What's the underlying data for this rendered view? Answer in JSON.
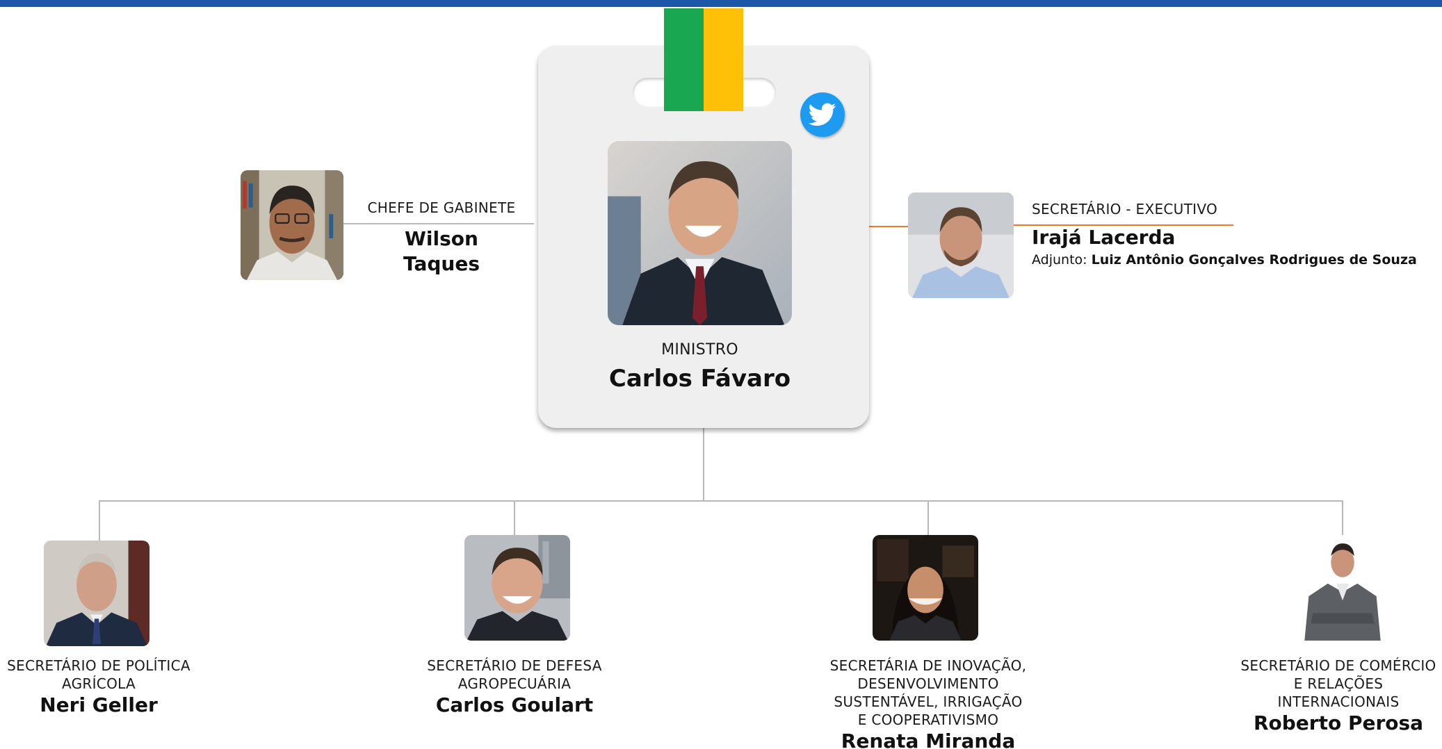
{
  "colors": {
    "top_rule": "#1d58a8",
    "connector": "#b8b8b8",
    "exec_connector": "#ef7d1e",
    "ribbon_green": "#1aa751",
    "ribbon_yellow": "#ffc107",
    "twitter": "#1d9bf0",
    "badge_bg": "#efefef"
  },
  "icons": {
    "twitter": "twitter-bird-icon"
  },
  "minister": {
    "role": "MINISTRO",
    "name": "Carlos Fávaro"
  },
  "chief_of_staff": {
    "role": "CHEFE DE GABINETE",
    "name_line1": "Wilson",
    "name_line2": "Taques"
  },
  "executive_secretary": {
    "role": "SECRETÁRIO - EXECUTIVO",
    "name": "Irajá Lacerda",
    "deputy_label": "Adjunto:",
    "deputy_name": "Luiz Antônio Gonçalves Rodrigues de Souza"
  },
  "secretaries": [
    {
      "role": "SECRETÁRIO DE POLÍTICA\nAGRÍCOLA",
      "name": "Neri Geller"
    },
    {
      "role": "SECRETÁRIO DE DEFESA\nAGROPECUÁRIA",
      "name": "Carlos Goulart"
    },
    {
      "role": "SECRETÁRIA DE INOVAÇÃO,\nDESENVOLVIMENTO\nSUSTENTÁVEL, IRRIGAÇÃO\nE COOPERATIVISMO",
      "name": "Renata Miranda"
    },
    {
      "role": "SECRETÁRIO DE COMÉRCIO\nE RELAÇÕES\nINTERNACIONAIS",
      "name": "Roberto Perosa"
    }
  ]
}
